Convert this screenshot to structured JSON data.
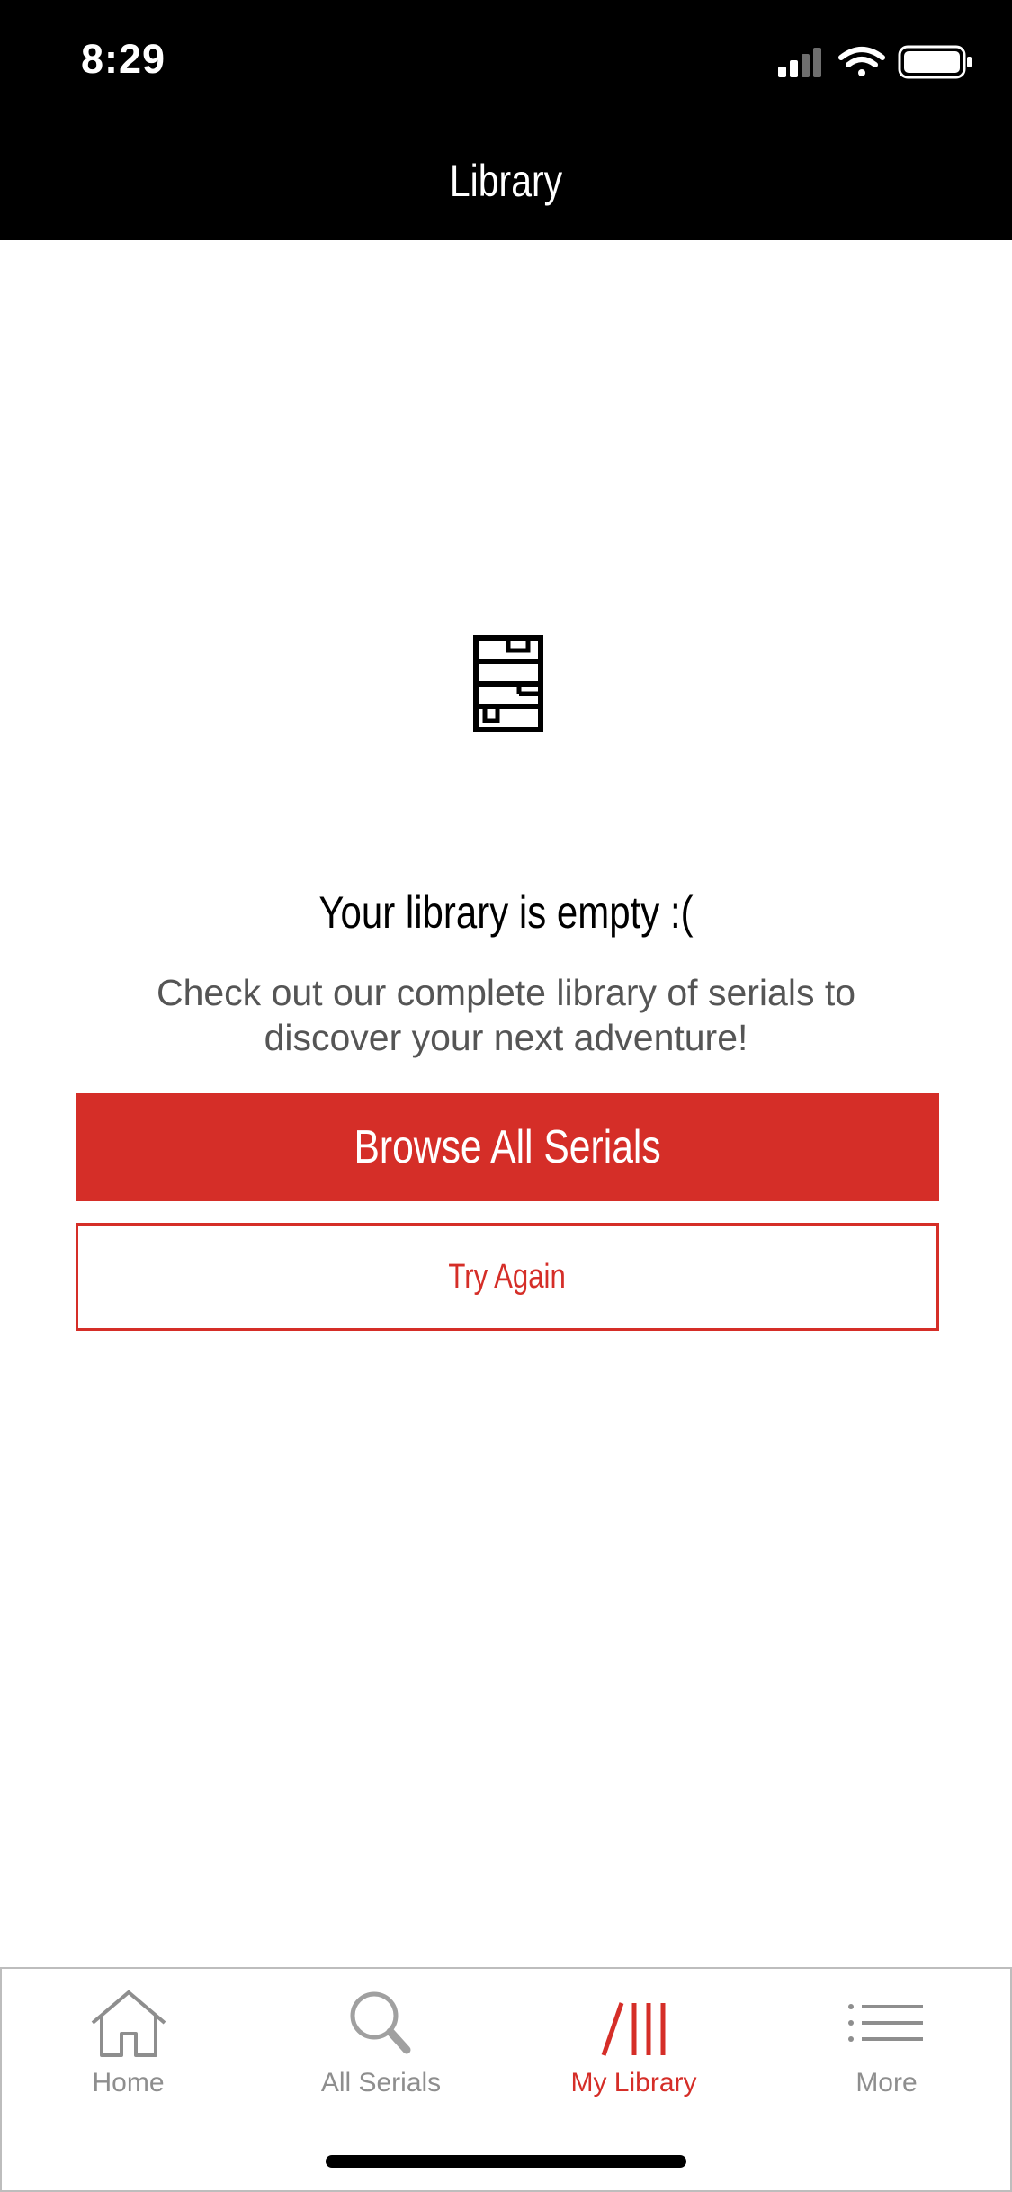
{
  "status_bar": {
    "time": "8:29"
  },
  "header": {
    "title": "Library"
  },
  "empty_state": {
    "icon": "bookshelf-icon",
    "title": "Your library is empty :(",
    "message": "Check out our complete library of serials to discover your next adventure!"
  },
  "actions": {
    "browse_label": "Browse All Serials",
    "retry_label": "Try Again"
  },
  "tab_bar": {
    "active_color": "#d52e28",
    "inactive_color": "#8e8e8e",
    "tabs": [
      {
        "label": "Home",
        "icon": "home-icon",
        "active": false
      },
      {
        "label": "All Serials",
        "icon": "search-icon",
        "active": false
      },
      {
        "label": "My Library",
        "icon": "library-icon",
        "active": true
      },
      {
        "label": "More",
        "icon": "menu-icon",
        "active": false
      }
    ]
  },
  "colors": {
    "accent": "#d52e28",
    "header_bg": "#000000",
    "text_secondary": "#555555"
  }
}
